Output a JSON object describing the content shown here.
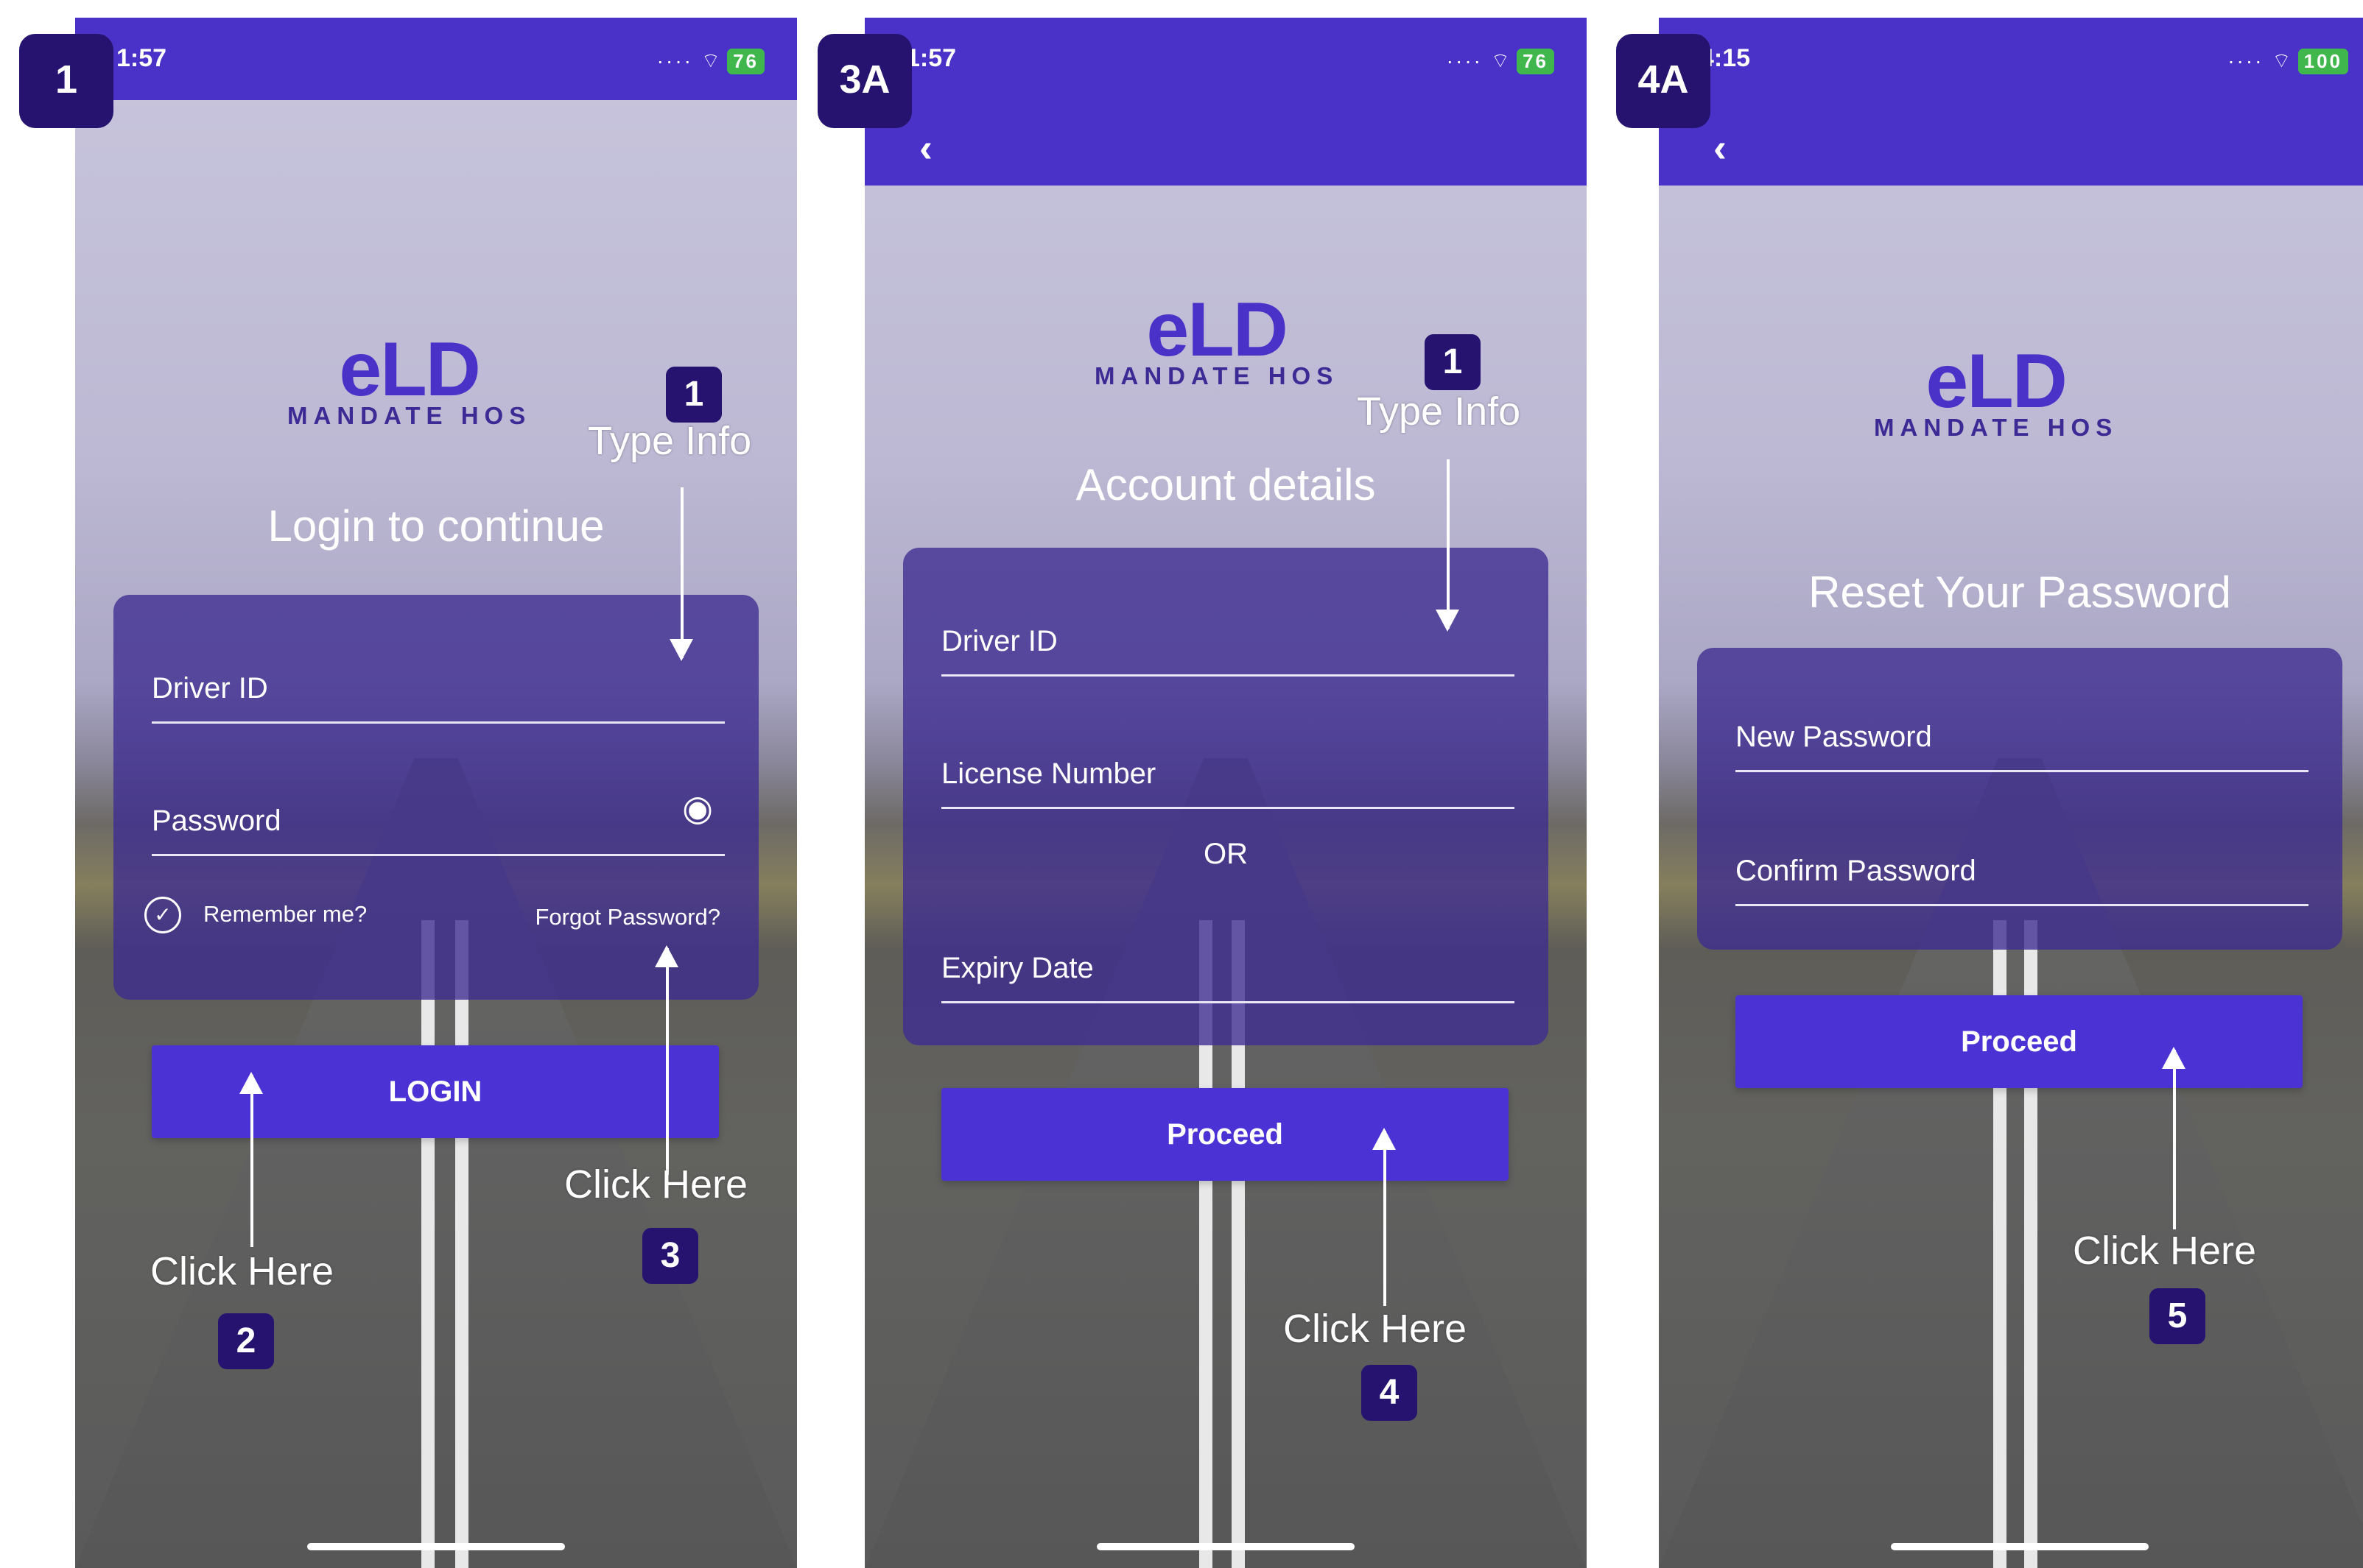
{
  "screens": [
    {
      "label": "1",
      "status": {
        "time": "1:57",
        "battery": "76"
      },
      "logo": {
        "main": "eLD",
        "sub": "MANDATE HOS"
      },
      "heading": "Login to continue",
      "fields": [
        "Driver ID",
        "Password"
      ],
      "remember_label": "Remember me?",
      "forgot_label": "Forgot Password?",
      "button_label": "LOGIN",
      "annotations": [
        {
          "number": "1",
          "text": "Type Info"
        },
        {
          "number": "2",
          "text": "Click Here"
        },
        {
          "number": "3",
          "text": "Click Here"
        }
      ]
    },
    {
      "label": "3A",
      "status": {
        "time": "1:57",
        "battery": "76"
      },
      "logo": {
        "main": "eLD",
        "sub": "MANDATE HOS"
      },
      "heading": "Account details",
      "fields": [
        "Driver ID",
        "License Number",
        "Expiry Date"
      ],
      "or_label": "OR",
      "button_label": "Proceed",
      "annotations": [
        {
          "number": "1",
          "text": "Type Info"
        },
        {
          "number": "4",
          "text": "Click Here"
        }
      ]
    },
    {
      "label": "4A",
      "status": {
        "time": "4:15",
        "battery": "100"
      },
      "logo": {
        "main": "eLD",
        "sub": "MANDATE HOS"
      },
      "heading": "Reset Your Password",
      "fields": [
        "New Password",
        "Confirm Password"
      ],
      "button_label": "Proceed",
      "annotations": [
        {
          "number": "5",
          "text": "Click Here"
        }
      ]
    }
  ],
  "colors": {
    "brand": "#4a32c9",
    "annotation_badge": "#25136f"
  },
  "icons": [
    "location-arrow-icon",
    "signal-icon",
    "wifi-icon",
    "battery-icon",
    "back-chevron-icon",
    "eye-icon",
    "check-circle-icon"
  ]
}
